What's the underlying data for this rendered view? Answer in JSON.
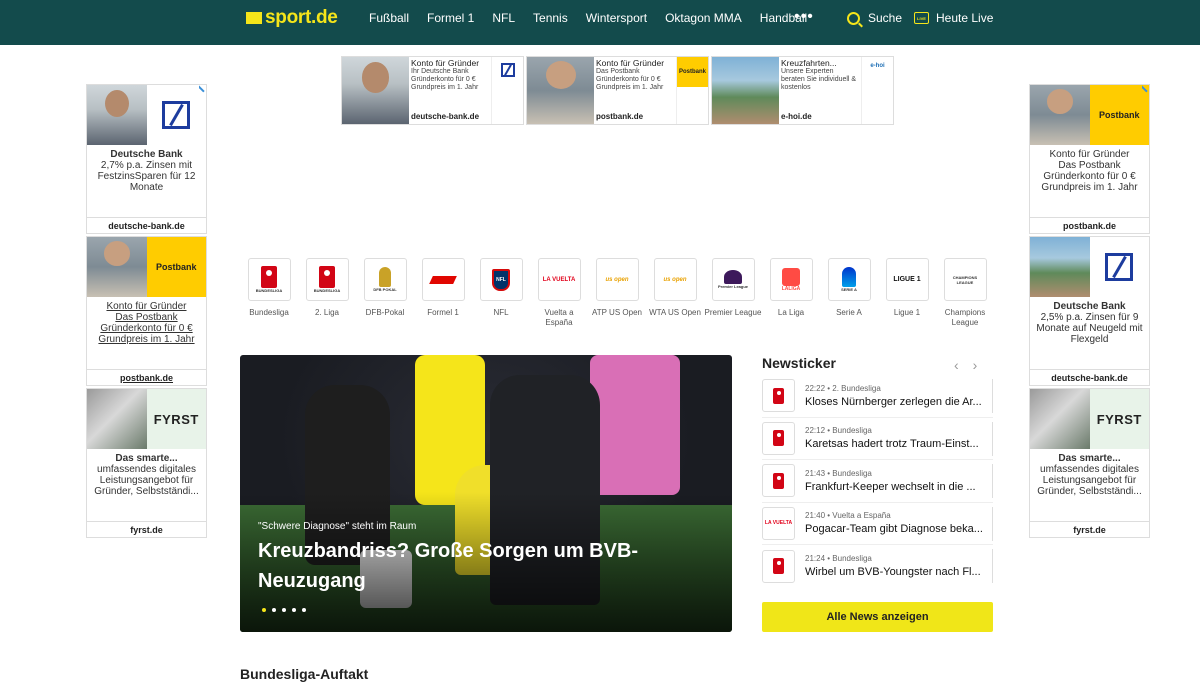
{
  "header": {
    "logo": "sport.de",
    "nav": [
      "Fußball",
      "Formel 1",
      "NFL",
      "Tennis",
      "Wintersport",
      "Oktagon MMA",
      "Handball"
    ],
    "more": "•••",
    "search_label": "Suche",
    "live_label": "Heute Live",
    "live_icon_text": "LIVE"
  },
  "top_ads": [
    {
      "title": "Konto für Gründer",
      "text": "Ihr Deutsche Bank Gründerkonto für 0 € Grundpreis im 1. Jahr",
      "domain": "deutsche-bank.de",
      "logo": "deutsche-bank-logo"
    },
    {
      "title": "Konto für Gründer",
      "text": "Das Postbank Gründerkonto für 0 € Grundpreis im 1. Jahr",
      "domain": "postbank.de",
      "logo": "postbank-logo",
      "logo_text": "Postbank"
    },
    {
      "title": "Kreuzfahrten...",
      "text": "Unsere Experten beraten Sie individuell & kostenlos",
      "domain": "e-hoi.de",
      "logo": "e-hoi-logo",
      "logo_text": "e-hoi"
    }
  ],
  "left_ads": [
    {
      "title": "Deutsche Bank",
      "text": "2,7% p.a. Zinsen mit FestzinsSparen für 12 Monate",
      "domain": "deutsche-bank.de"
    },
    {
      "title": "Konto für Gründer",
      "text": "Das Postbank Gründerkonto für 0 € Grundpreis im 1. Jahr",
      "domain": "postbank.de",
      "logo_text": "Postbank"
    },
    {
      "title": "Das smarte...",
      "text": "umfassendes digitales Leistungsangebot für Gründer, Selbstständi...",
      "domain": "fyrst.de",
      "logo_text": "FYRST"
    }
  ],
  "right_ads": [
    {
      "title": "Konto für Gründer",
      "text": "Das Postbank Gründerkonto für 0 € Grundpreis im 1. Jahr",
      "domain": "postbank.de",
      "logo_text": "Postbank"
    },
    {
      "title": "Deutsche Bank",
      "text": "2,5% p.a. Zinsen für 9 Monate auf Neugeld mit Flexgeld",
      "domain": "deutsche-bank.de"
    },
    {
      "title": "Das smarte...",
      "text": "umfassendes digitales Leistungsangebot für Gründer, Selbstständi...",
      "domain": "fyrst.de",
      "logo_text": "FYRST"
    }
  ],
  "categories": [
    {
      "label": "Bundesliga",
      "icon": "bundesliga-icon",
      "icon_text": "BUNDESLIGA"
    },
    {
      "label": "2. Liga",
      "icon": "bundesliga2-icon",
      "icon_text": "BUNDESLIGA"
    },
    {
      "label": "DFB-Pokal",
      "icon": "dfb-pokal-icon",
      "icon_text": "DFB POKAL"
    },
    {
      "label": "Formel 1",
      "icon": "formel1-icon"
    },
    {
      "label": "NFL",
      "icon": "nfl-icon",
      "icon_text": "NFL"
    },
    {
      "label": "Vuelta a España",
      "icon": "vuelta-icon",
      "icon_text": "LA VUELTA"
    },
    {
      "label": "ATP US Open",
      "icon": "us-open-icon",
      "icon_text": "us open"
    },
    {
      "label": "WTA US Open",
      "icon": "us-open-icon",
      "icon_text": "us open"
    },
    {
      "label": "Premier League",
      "icon": "premier-league-icon",
      "icon_text": "Premier League"
    },
    {
      "label": "La Liga",
      "icon": "laliga-icon",
      "icon_text": "LALIGA"
    },
    {
      "label": "Serie A",
      "icon": "serie-a-icon",
      "icon_text": "SERIE A"
    },
    {
      "label": "Ligue 1",
      "icon": "ligue1-icon",
      "icon_text": "LIGUE 1"
    },
    {
      "label": "Champions League",
      "icon": "champions-league-icon",
      "icon_text": "CHAMPIONS LEAGUE"
    }
  ],
  "hero": {
    "kicker": "\"Schwere Diagnose\" steht im Raum",
    "title": "Kreuzbandriss? Große Sorgen um BVB-Neuzugang",
    "dots": 5,
    "active_dot": 0
  },
  "newsticker": {
    "title": "Newsticker",
    "prev": "‹",
    "next": "›",
    "items": [
      {
        "time": "22:22",
        "league": "2. Bundesliga",
        "headline": "Kloses Nürnberger zerlegen die Ar...",
        "icon": "bundesliga2-icon"
      },
      {
        "time": "22:12",
        "league": "Bundesliga",
        "headline": "Karetsas hadert trotz Traum-Einst...",
        "icon": "bundesliga-icon"
      },
      {
        "time": "21:43",
        "league": "Bundesliga",
        "headline": "Frankfurt-Keeper wechselt in die ...",
        "icon": "bundesliga-icon"
      },
      {
        "time": "21:40",
        "league": "Vuelta a España",
        "headline": "Pogacar-Team gibt Diagnose beka...",
        "icon": "vuelta-icon",
        "icon_text": "LA VUELTA"
      },
      {
        "time": "21:24",
        "league": "Bundesliga",
        "headline": "Wirbel um BVB-Youngster nach Fl...",
        "icon": "bundesliga-icon"
      }
    ],
    "all_news_label": "Alle News anzeigen"
  },
  "section": {
    "title": "Bundesliga-Auftakt"
  },
  "colors": {
    "header_bg": "#134b4c",
    "accent": "#f5e51a",
    "button": "#f0e618"
  }
}
